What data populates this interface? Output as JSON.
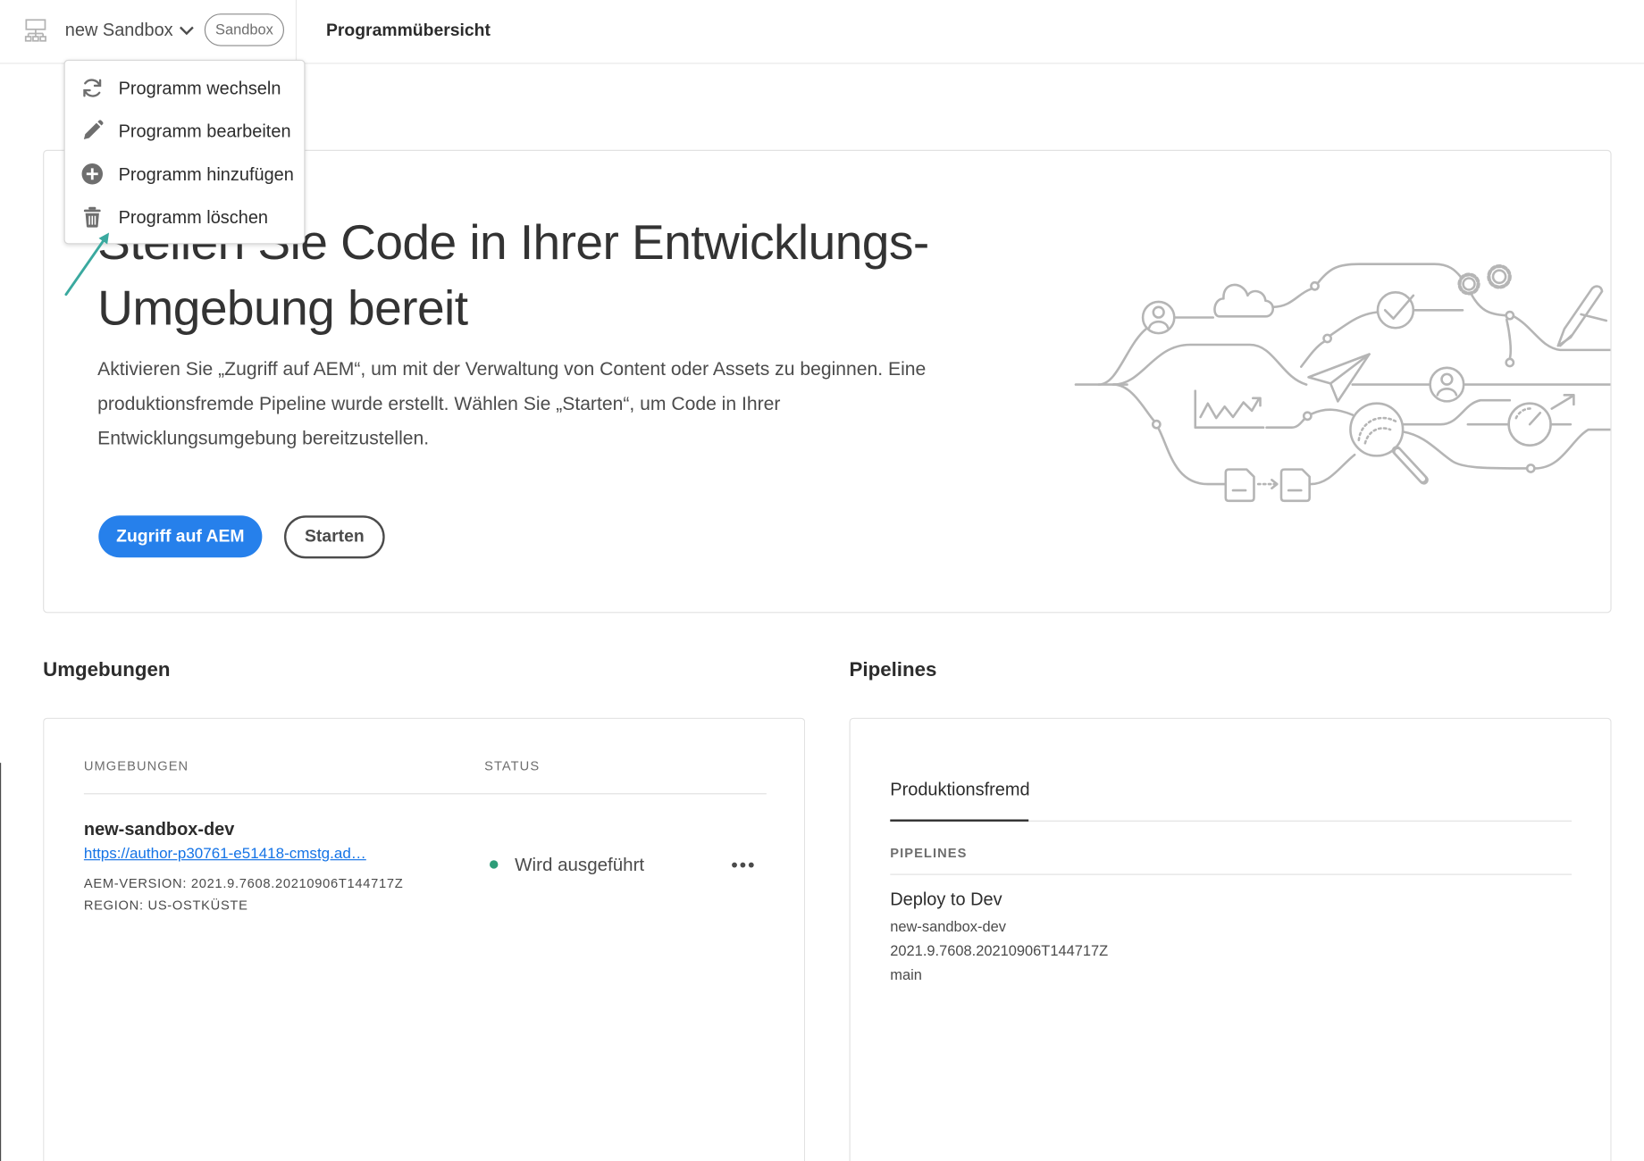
{
  "header": {
    "program_icon": "server-hierarchy-icon",
    "program_name": "new Sandbox",
    "program_switcher_icon": "chevron-down-icon",
    "program_badge": "Sandbox",
    "page_title": "Programmübersicht"
  },
  "program_menu": {
    "items": [
      {
        "icon": "refresh-icon",
        "label": "Programm wechseln"
      },
      {
        "icon": "pencil-icon",
        "label": "Programm bearbeiten"
      },
      {
        "icon": "add-circle-icon",
        "label": "Programm hinzufügen"
      },
      {
        "icon": "trash-icon",
        "label": "Programm löschen"
      }
    ]
  },
  "hero": {
    "title_lines": [
      "Stellen Sie Code in Ihrer Entwicklungs-",
      "Umgebung bereit"
    ],
    "description_lines": [
      "Aktivieren Sie „Zugriff auf AEM“, um mit der Verwaltung von Content oder Assets zu beginnen. Eine",
      "produktionsfremde Pipeline wurde erstellt. Wählen Sie „Starten“, um Code in Ihrer",
      "Entwicklungsumgebung bereitzustellen."
    ],
    "primary_button": "Zugriff auf AEM",
    "secondary_button": "Starten"
  },
  "environments": {
    "section_title": "Umgebungen",
    "columns": [
      "UMGEBUNGEN",
      "STATUS"
    ],
    "rows": [
      {
        "name": "new-sandbox-dev",
        "url": "https://author-p30761-e51418-cmstg.ad…",
        "aem_version": "AEM-VERSION: 2021.9.7608.20210906T144717Z",
        "region": "REGION: US-OSTKÜSTE",
        "status": "Wird ausgeführt",
        "more_icon": "more-horizontal-icon"
      }
    ]
  },
  "pipelines": {
    "section_title": "Pipelines",
    "tabs": [
      {
        "label": "Produktionsfremd",
        "selected": true
      }
    ],
    "list_header": "PIPELINES",
    "items": [
      {
        "name": "Deploy to Dev",
        "environment": "new-sandbox-dev",
        "version": "2021.9.7608.20210906T144717Z",
        "branch": "main"
      }
    ]
  },
  "theme": {
    "accent": "#2680eb",
    "link": "#1473e6",
    "status_running": "#2d9d78",
    "callout_arrow": "#3aa99f",
    "text": "#2c2c2c",
    "border": "#e1e1e1"
  }
}
